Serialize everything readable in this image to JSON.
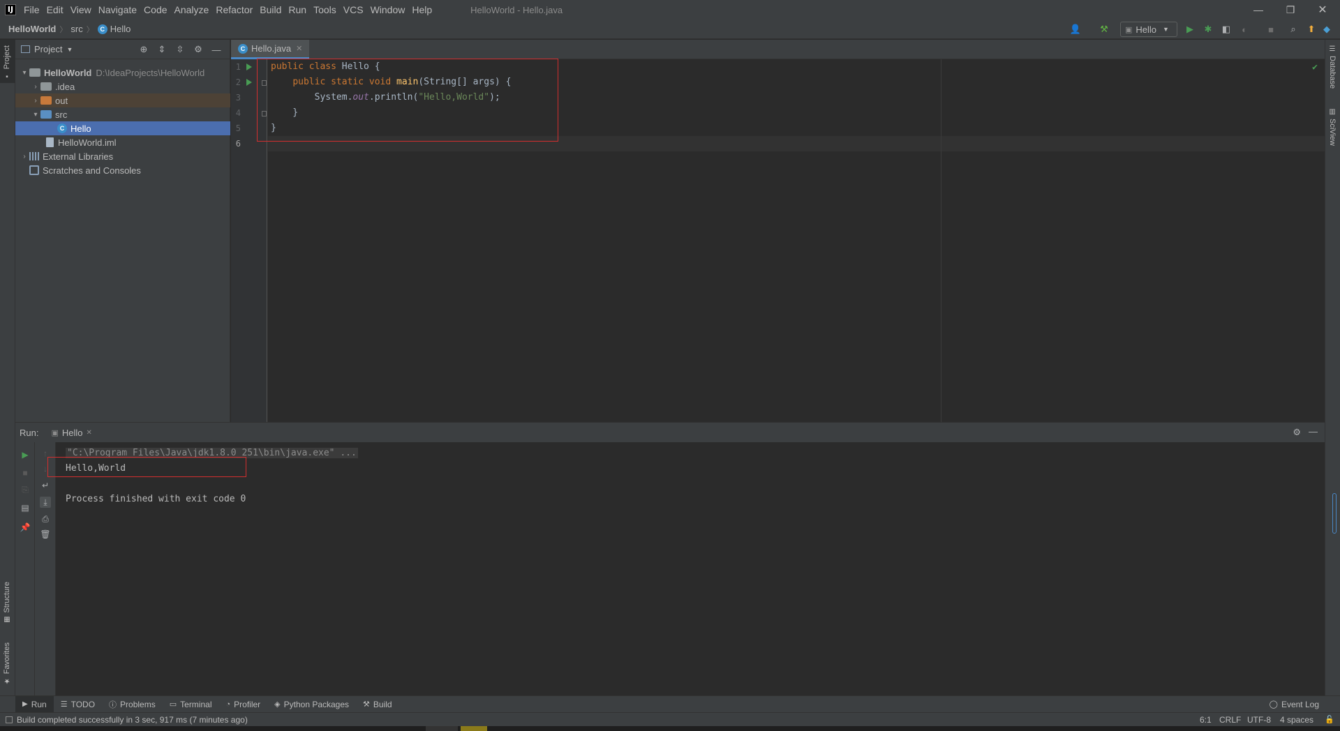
{
  "window": {
    "title": "HelloWorld - Hello.java",
    "menu": [
      "File",
      "Edit",
      "View",
      "Navigate",
      "Code",
      "Analyze",
      "Refactor",
      "Build",
      "Run",
      "Tools",
      "VCS",
      "Window",
      "Help"
    ],
    "logo_text": "IJ"
  },
  "breadcrumb": {
    "project": "HelloWorld",
    "folder": "src",
    "file": "Hello"
  },
  "toolbar": {
    "run_config": "Hello"
  },
  "left_strip": {
    "project_tab": "Project",
    "structure_tab": "Structure",
    "favorites_tab": "Favorites"
  },
  "right_strip": {
    "database_tab": "Database",
    "sciview_tab": "SciView"
  },
  "project_panel": {
    "title": "Project",
    "tree": {
      "root_name": "HelloWorld",
      "root_path": "D:\\IdeaProjects\\HelloWorld",
      "idea": ".idea",
      "out": "out",
      "src": "src",
      "hello": "Hello",
      "iml": "HelloWorld.iml",
      "libs": "External Libraries",
      "scratches": "Scratches and Consoles"
    }
  },
  "editor": {
    "tab_label": "Hello.java",
    "line_numbers": [
      "1",
      "2",
      "3",
      "4",
      "5",
      "6"
    ],
    "code": {
      "l1_kw": "public class ",
      "l1_rest": "Hello {",
      "l2_indent": "    ",
      "l2_kw": "public static void ",
      "l2_fn": "main",
      "l2_rest": "(String[] args) {",
      "l3_pre": "        System.",
      "l3_field": "out",
      "l3_mid": ".println(",
      "l3_str": "\"Hello,World\"",
      "l3_end": ");",
      "l4": "    }",
      "l5": "}"
    }
  },
  "run_panel": {
    "label": "Run:",
    "tab_label": "Hello",
    "command": "\"C:\\Program Files\\Java\\jdk1.8.0_251\\bin\\java.exe\" ...",
    "output": "Hello,World",
    "exit_message": "Process finished with exit code 0"
  },
  "bottom_tools": [
    "Run",
    "TODO",
    "Problems",
    "Terminal",
    "Profiler",
    "Python Packages",
    "Build"
  ],
  "event_log": "Event Log",
  "status": {
    "message": "Build completed successfully in 3 sec, 917 ms (7 minutes ago)",
    "position": "6:1",
    "line_sep": "CRLF",
    "encoding": "UTF-8",
    "indent": "4 spaces"
  },
  "colors": {
    "accent": "#4b6eaf",
    "highlight_box": "#d32f2f",
    "run_green": "#499c54"
  }
}
